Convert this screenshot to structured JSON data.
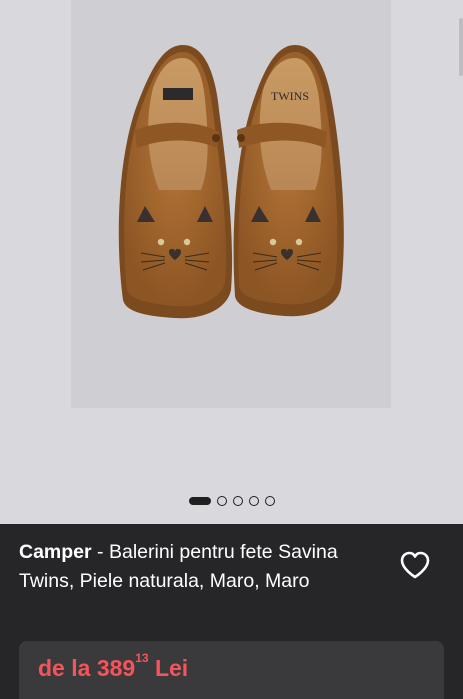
{
  "product": {
    "brand": "Camper",
    "separator": " - ",
    "name": "Balerini pentru fete Savina Twins, Piele naturala, Maro, Maro",
    "image_icon": "shoe-photo",
    "favorite_icon": "heart-outline-icon"
  },
  "gallery": {
    "total_images": 5,
    "active_index": 0
  },
  "price": {
    "prefix": "de la",
    "integer": "389",
    "decimals": "13",
    "currency": "Lei",
    "color": "#f4545a"
  },
  "colors": {
    "gallery_bg": "#d9d8dc",
    "info_bg": "#262628",
    "card_bg": "#3a3a3d",
    "leather": "#a0652d"
  }
}
